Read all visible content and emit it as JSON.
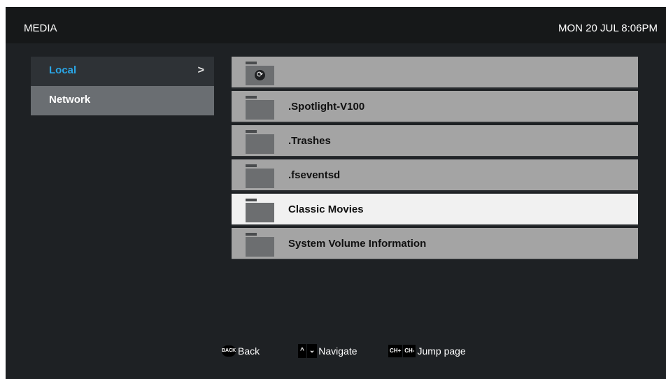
{
  "header": {
    "title": "MEDIA",
    "clock": "MON 20 JUL 8:06PM"
  },
  "sidebar": {
    "items": [
      {
        "label": "Local",
        "chevron": ">"
      },
      {
        "label": "Network"
      }
    ]
  },
  "files": [
    {
      "label": "",
      "icon": "refresh-folder-icon"
    },
    {
      "label": ".Spotlight-V100",
      "icon": "folder-icon"
    },
    {
      "label": ".Trashes",
      "icon": "folder-icon"
    },
    {
      "label": ".fseventsd",
      "icon": "folder-icon"
    },
    {
      "label": "Classic Movies",
      "icon": "folder-icon",
      "selected": true
    },
    {
      "label": "System Volume Information",
      "icon": "folder-icon"
    }
  ],
  "footer": {
    "back": {
      "badge": "BACK",
      "label": "Back"
    },
    "navigate": {
      "up": "^",
      "down": "v",
      "label": "Navigate"
    },
    "jump": {
      "ch_plus": "CH+",
      "ch_minus": "CH-",
      "label": "Jump page"
    }
  }
}
